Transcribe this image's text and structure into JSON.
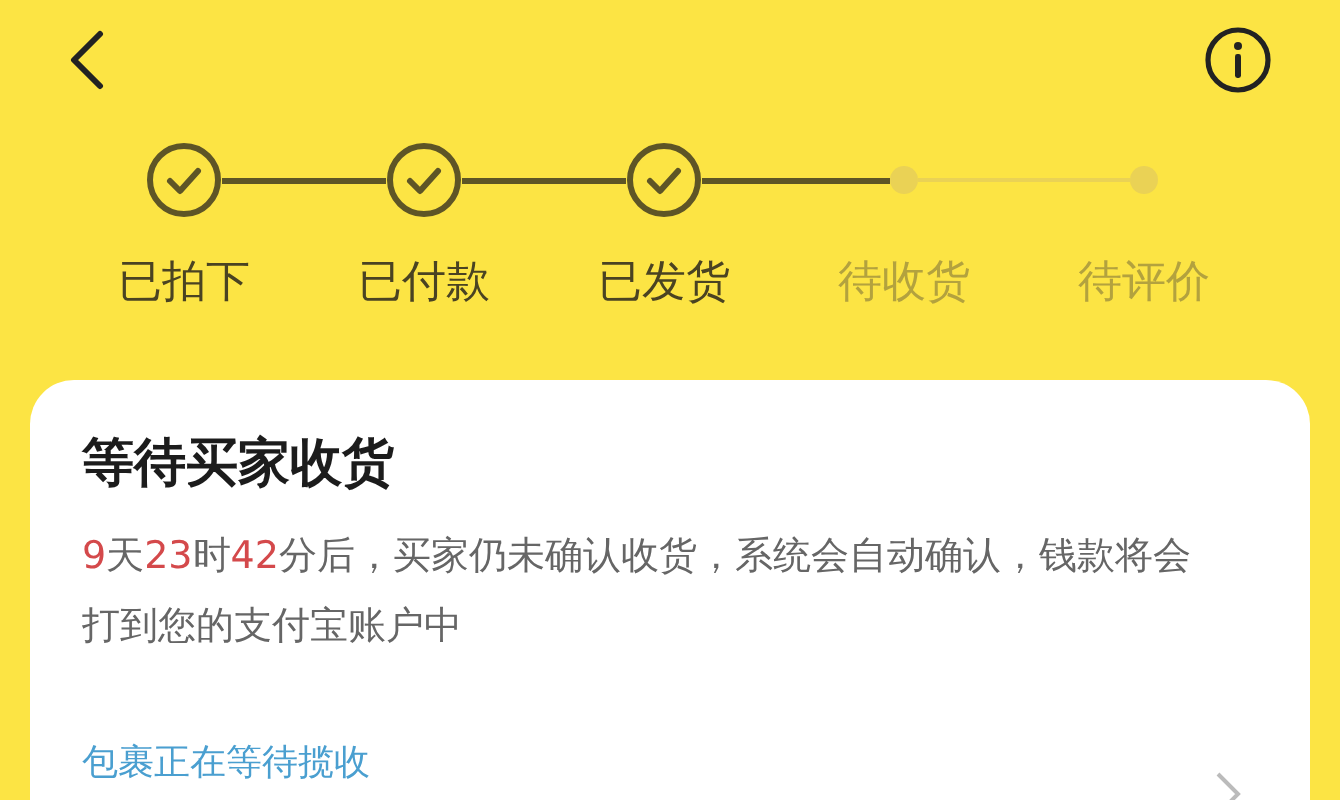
{
  "steps": [
    {
      "label": "已拍下",
      "done": true
    },
    {
      "label": "已付款",
      "done": true
    },
    {
      "label": "已发货",
      "done": true
    },
    {
      "label": "待收货",
      "done": false
    },
    {
      "label": "待评价",
      "done": false
    }
  ],
  "card": {
    "title": "等待买家收货",
    "notice": [
      {
        "text": "9",
        "highlight": true
      },
      {
        "text": "天",
        "highlight": false
      },
      {
        "text": "23",
        "highlight": true
      },
      {
        "text": "时",
        "highlight": false
      },
      {
        "text": "42",
        "highlight": true
      },
      {
        "text": "分后，买家仍未确认收货，系统会自动确认，钱款将会打到您的支付宝账户中",
        "highlight": false
      }
    ],
    "link": "包裹正在等待揽收"
  }
}
